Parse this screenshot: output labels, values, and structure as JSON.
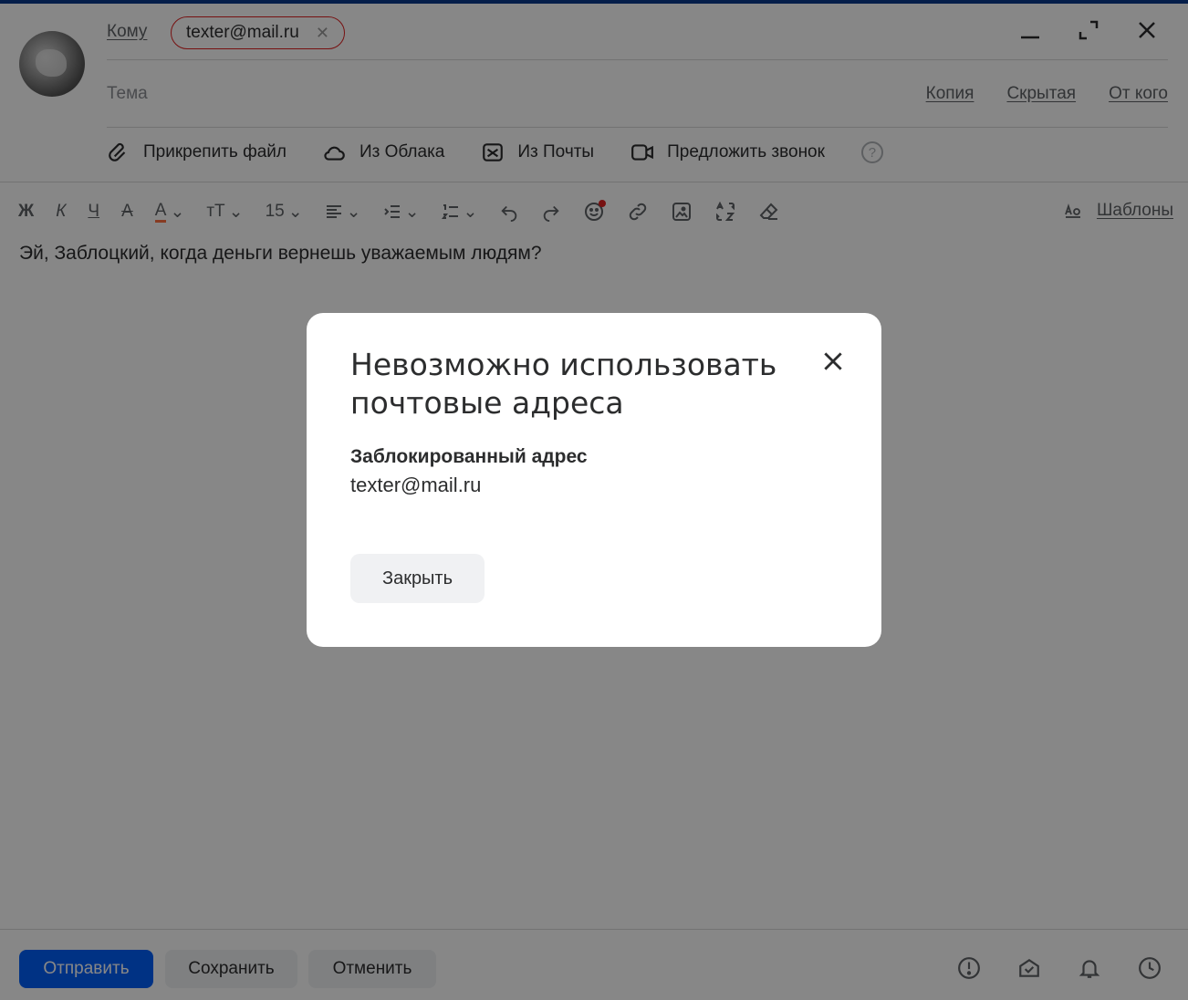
{
  "header": {
    "to_label": "Кому",
    "recipient_chip": {
      "email": "texter@mail.ru",
      "status": "blocked",
      "border_color": "#e02020"
    },
    "subject_placeholder": "Тема",
    "links": [
      "Копия",
      "Скрытая",
      "От кого"
    ],
    "window_buttons": [
      "minimize-icon",
      "expand-icon",
      "close-icon"
    ]
  },
  "attach_bar": {
    "items": [
      {
        "label": "Прикрепить файл",
        "icon": "paperclip-icon"
      },
      {
        "label": "Из Облака",
        "icon": "cloud-icon"
      },
      {
        "label": "Из Почты",
        "icon": "mail-icon"
      },
      {
        "label": "Предложить звонок",
        "icon": "video-call-icon"
      }
    ],
    "help_glyph": "?"
  },
  "format_toolbar": {
    "bold": "Ж",
    "italic": "К",
    "underline": "Ч",
    "strike": "А",
    "font_color": "А",
    "font_size_glyph": "тТ",
    "font_size_value": "15",
    "templates_label": "Шаблоны"
  },
  "body": {
    "text": "Эй, Заблоцкий, когда деньги вернешь уважаемым людям?"
  },
  "footer": {
    "send": "Отправить",
    "save": "Сохранить",
    "cancel": "Отменить",
    "icons": [
      "importance-icon",
      "read-receipt-icon",
      "reminder-icon",
      "schedule-icon"
    ]
  },
  "modal": {
    "title": "Невозможно использовать почтовые адреса",
    "subtitle": "Заблокированный адрес",
    "address": "texter@mail.ru",
    "close_button": "Закрыть"
  },
  "colors": {
    "accent": "#005ff9",
    "overlay": "rgba(0,0,0,0.47)",
    "chip_error": "#e02020",
    "emoji_dot": "#e02020"
  }
}
